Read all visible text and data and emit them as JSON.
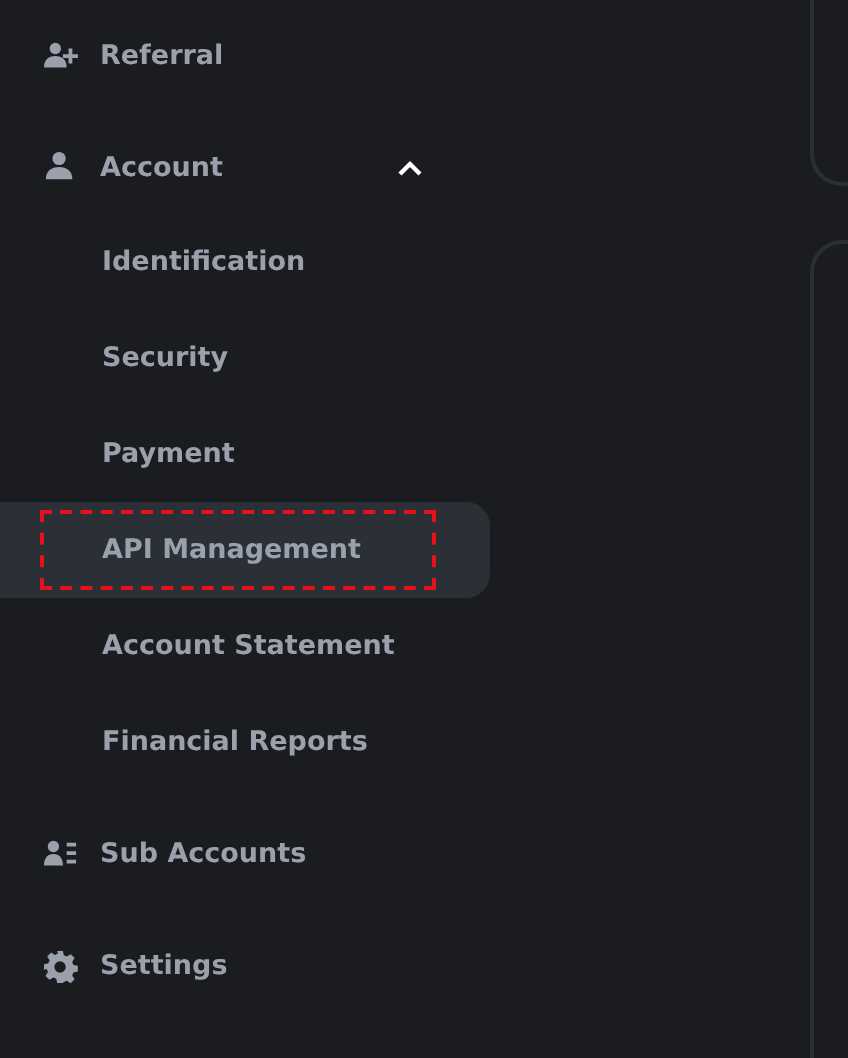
{
  "sidebar": {
    "items": [
      {
        "kind": "link",
        "label": "Referral"
      },
      {
        "kind": "group",
        "label": "Account",
        "expanded": true,
        "children": [
          {
            "label": "Identification",
            "selected": false,
            "annotated": false
          },
          {
            "label": "Security",
            "selected": false,
            "annotated": false
          },
          {
            "label": "Payment",
            "selected": false,
            "annotated": false
          },
          {
            "label": "API Management",
            "selected": true,
            "annotated": true
          },
          {
            "label": "Account Statement",
            "selected": false,
            "annotated": false
          },
          {
            "label": "Financial Reports",
            "selected": false,
            "annotated": false
          }
        ]
      },
      {
        "kind": "link",
        "label": "Sub Accounts"
      },
      {
        "kind": "link",
        "label": "Settings"
      }
    ]
  }
}
